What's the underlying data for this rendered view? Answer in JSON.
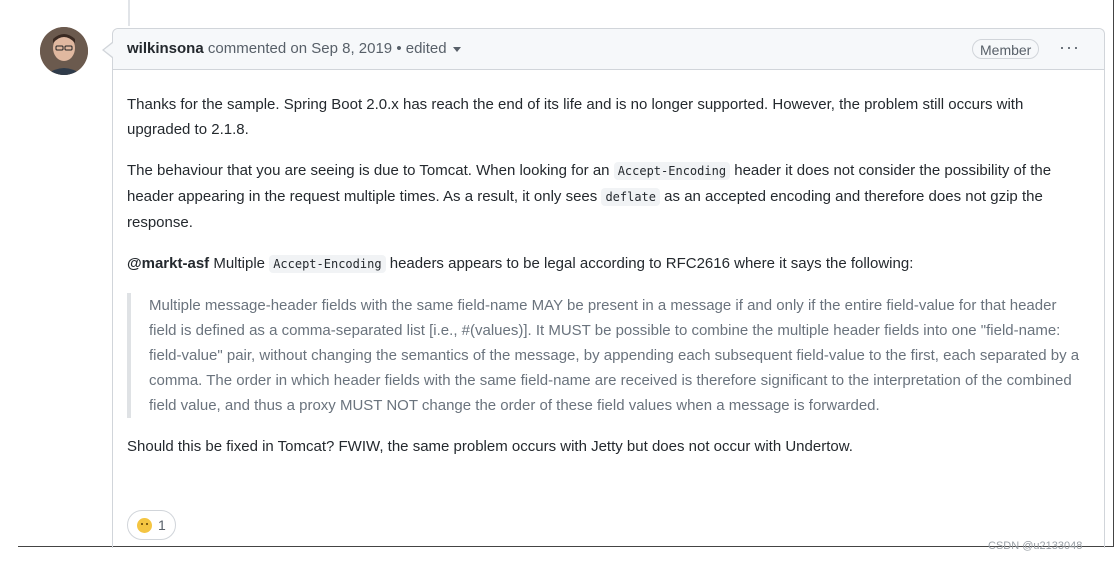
{
  "comment": {
    "author": "wilkinsona",
    "meta": "commented on Sep 8, 2019 • edited",
    "badge": "Member",
    "more_label": "···",
    "paragraphs": {
      "p1": "Thanks for the sample. Spring Boot 2.0.x has reach the end of its life and is no longer supported. However, the problem still occurs with upgraded to 2.1.8.",
      "p2_a": "The behaviour that you are seeing is due to Tomcat. When looking for an ",
      "p2_code1": "Accept-Encoding",
      "p2_b": " header it does not consider the possibility of the header appearing in the request multiple times. As a result, it only sees ",
      "p2_code2": "deflate",
      "p2_c": " as an accepted encoding and therefore does not gzip the response.",
      "p3_mention": "@markt-asf",
      "p3_a": " Multiple ",
      "p3_code": "Accept-Encoding",
      "p3_b": " headers appears to be legal according to RFC2616 where it says the following:",
      "quote": "Multiple message-header fields with the same field-name MAY be present in a message if and only if the entire field-value for that header field is defined as a comma-separated list [i.e., #(values)]. It MUST be possible to combine the multiple header fields into one \"field-name: field-value\" pair, without changing the semantics of the message, by appending each subsequent field-value to the first, each separated by a comma. The order in which header fields with the same field-name are received is therefore significant to the interpretation of the combined field value, and thus a proxy MUST NOT change the order of these field values when a message is forwarded.",
      "p4": "Should this be fixed in Tomcat? FWIW, the same problem occurs with Jetty but does not occur with Undertow."
    },
    "reaction": {
      "icon": "confused-face-icon",
      "count": "1"
    }
  },
  "watermark": "CSDN @u2133048",
  "colors": {
    "header_bg": "#f6f8fa",
    "border": "#d1d5da",
    "muted": "#586069",
    "quote_text": "#6a737d"
  }
}
